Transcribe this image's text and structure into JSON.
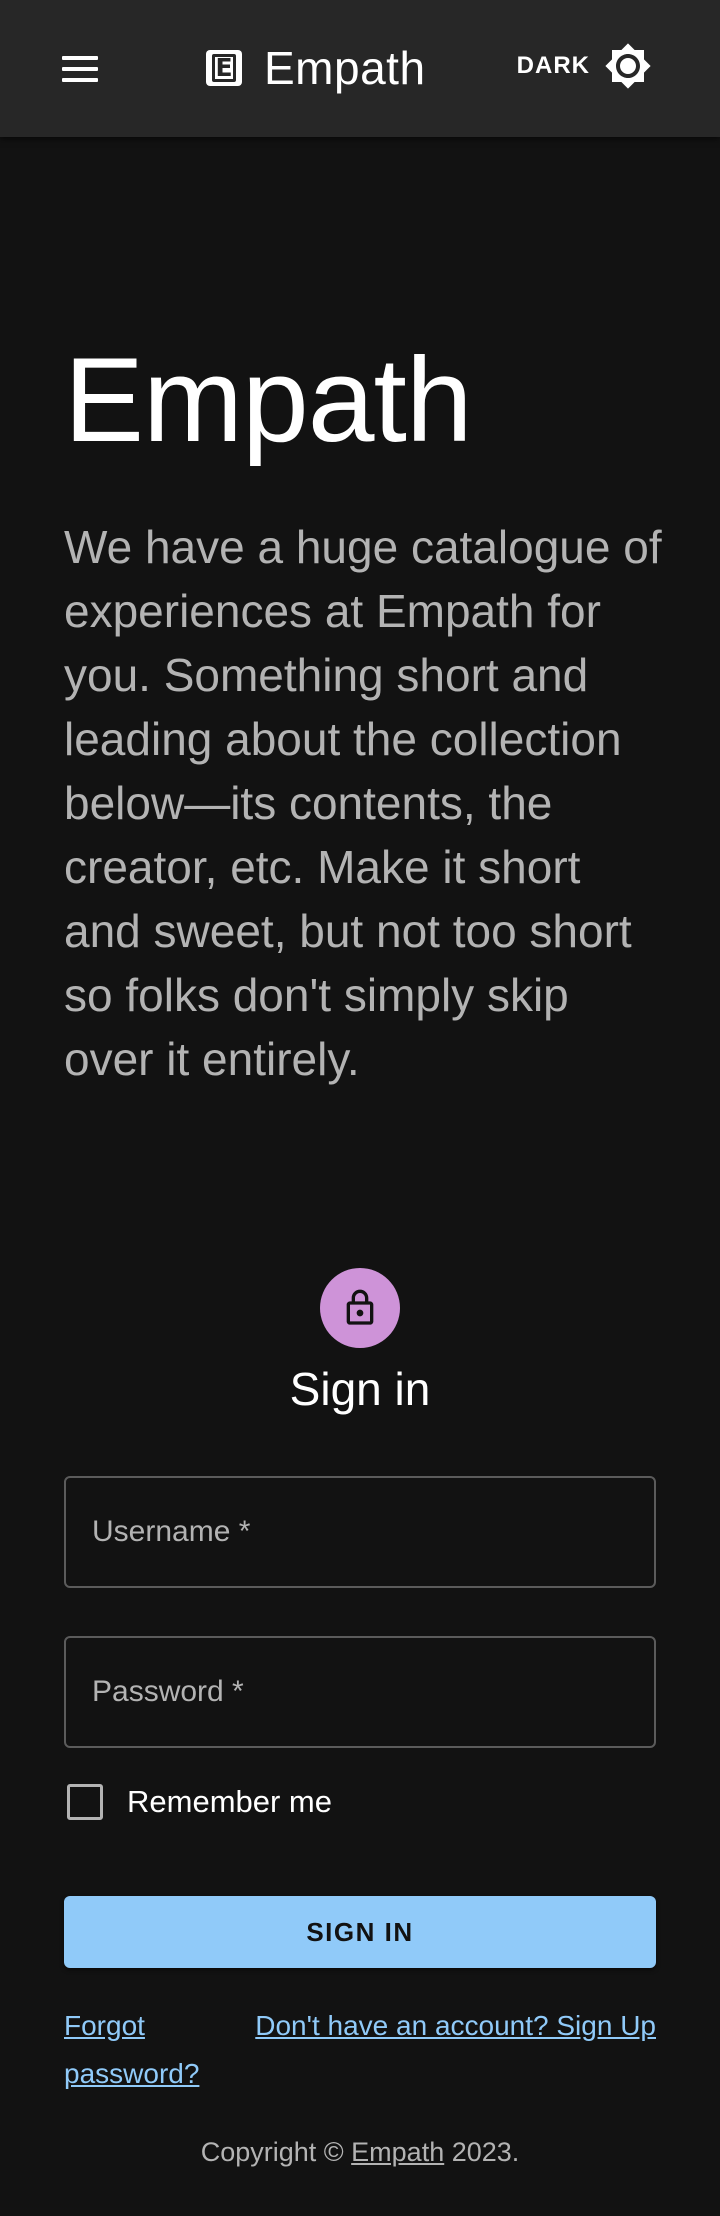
{
  "appbar": {
    "brand_logo_letter": "E",
    "brand_name": "Empath",
    "theme_label": "DARK",
    "menu_icon": "menu-icon",
    "theme_icon": "brightness-icon"
  },
  "hero": {
    "title": "Empath",
    "description": "We have a huge catalogue of experiences at Empath for you. Something short and leading about the collection below—its contents, the creator, etc. Make it short and sweet, but not too short so folks don't simply skip over it entirely."
  },
  "signin": {
    "title": "Sign in",
    "lock_icon": "lock-icon",
    "username_placeholder": "Username *",
    "username_value": "",
    "password_placeholder": "Password *",
    "password_value": "",
    "remember_label": "Remember me",
    "remember_checked": false,
    "submit_label": "SIGN IN",
    "forgot_link": "Forgot password?",
    "signup_link": "Don't have an account? Sign Up"
  },
  "footer": {
    "prefix": "Copyright © ",
    "link": "Empath",
    "suffix": " 2023."
  },
  "colors": {
    "background": "#121212",
    "appbar": "#272727",
    "accent": "#90caf9",
    "avatar": "#ce93d8",
    "muted_text": "#b3b3b3"
  }
}
